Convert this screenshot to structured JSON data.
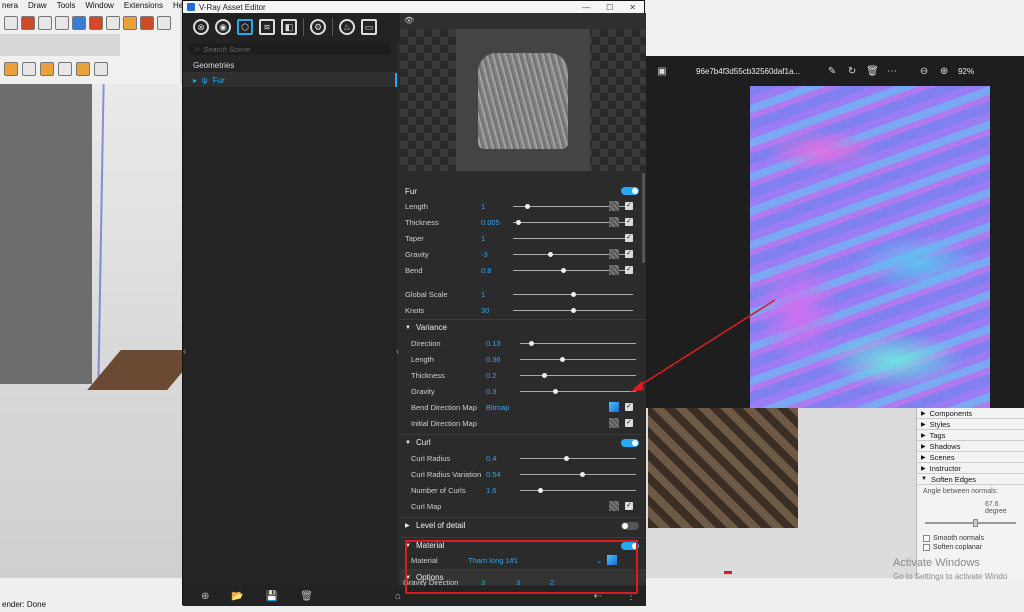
{
  "sketchup": {
    "menu": [
      "nera",
      "Draw",
      "Tools",
      "Window",
      "Extensions",
      "Help"
    ],
    "status": "ender: Done",
    "trays": {
      "items": [
        "Components",
        "Styles",
        "Tags",
        "Shadows",
        "Scenes",
        "Instructor",
        "Soften Edges"
      ],
      "soften_label": "Angle between normals:",
      "angle_value": "67.6  degree",
      "smooth_normals": "Smooth normals",
      "soften_coplanar": "Soften coplanar"
    }
  },
  "activate": {
    "line1": "Activate Windows",
    "line2": "Go to Settings to activate Windo"
  },
  "photo_viewer": {
    "filename": "96e7b4f3d55cb32560daf1a...",
    "zoom": "92%"
  },
  "vray": {
    "title": "V-Ray Asset Editor",
    "search_placeholder": "Search Scene",
    "tree_header": "Geometries",
    "tree_item": "Fur",
    "fur": {
      "section": "Fur",
      "rows": [
        {
          "label": "Length",
          "value": "1",
          "slider": 0.1
        },
        {
          "label": "Thickness",
          "value": "0.005",
          "slider": 0.03
        },
        {
          "label": "Taper",
          "value": "1",
          "slider": 1.0
        },
        {
          "label": "Gravity",
          "value": "-3",
          "slider": 0.3
        },
        {
          "label": "Bend",
          "value": "0.8",
          "slider": 0.42
        },
        {
          "label": "Global Scale",
          "value": "1",
          "slider": 0.5
        },
        {
          "label": "Knots",
          "value": "30",
          "slider": 0.5
        }
      ]
    },
    "variance": {
      "section": "Variance",
      "rows": [
        {
          "label": "Direction",
          "value": "0.13",
          "slider": 0.08
        },
        {
          "label": "Length",
          "value": "0.36",
          "slider": 0.36
        },
        {
          "label": "Thickness",
          "value": "0.2",
          "slider": 0.2
        },
        {
          "label": "Gravity",
          "value": "0.3",
          "slider": 0.3
        }
      ],
      "bend_dir_map_label": "Bend Direction Map",
      "bend_dir_map_value": "Bitmap",
      "initial_dir_map_label": "Initial Direction Map"
    },
    "curl": {
      "section": "Curl",
      "rows": [
        {
          "label": "Curl Radius",
          "value": "0.4",
          "slider": 0.4
        },
        {
          "label": "Curl Radius Variation",
          "value": "0.54",
          "slider": 0.54
        },
        {
          "label": "Number of Curls",
          "value": "1.6",
          "slider": 0.16
        }
      ],
      "curl_map_label": "Curl Map"
    },
    "lod": {
      "section": "Level of detail"
    },
    "material": {
      "section": "Material",
      "label": "Material",
      "value": "Tham long 1#1"
    },
    "options": {
      "section": "Options",
      "gravity_label": "Gravity Direction",
      "gravity_values": [
        "3",
        "3",
        "2"
      ]
    }
  },
  "colors": {
    "accent": "#27a8f0",
    "annotation": "#d61e1e"
  }
}
